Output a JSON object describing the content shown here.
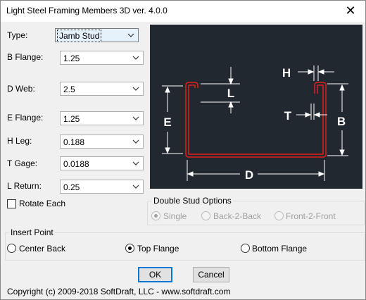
{
  "window": {
    "title": "Light Steel Framing Members 3D ver. 4.0.0",
    "close_glyph": "✕"
  },
  "fields": [
    {
      "label": "Type:",
      "value": "Jamb Stud"
    },
    {
      "label": "B Flange:",
      "value": "1.25"
    },
    {
      "label": "D Web:",
      "value": "2.5"
    },
    {
      "label": "E Flange:",
      "value": "1.25"
    },
    {
      "label": "H Leg:",
      "value": "0.188"
    },
    {
      "label": "T Gage:",
      "value": "0.0188"
    },
    {
      "label": "L Return:",
      "value": "0.25"
    }
  ],
  "rotate_each": {
    "label": "Rotate Each",
    "checked": false
  },
  "preview": {
    "labels": {
      "H": "H",
      "L": "L",
      "E": "E",
      "T": "T",
      "B": "B",
      "D": "D"
    },
    "colors": {
      "background": "#21282f",
      "profile": "#e0201c",
      "dimension": "#ffffff"
    }
  },
  "double_stud": {
    "title": "Double Stud Options",
    "options": [
      "Single",
      "Back-2-Back",
      "Front-2-Front"
    ],
    "selected": "Single",
    "disabled": true
  },
  "insert_point": {
    "title": "Insert Point",
    "options": [
      "Center Back",
      "Top Flange",
      "Bottom Flange"
    ],
    "selected": "Top Flange"
  },
  "buttons": {
    "ok": "OK",
    "cancel": "Cancel"
  },
  "copyright": "Copyright (c) 2009-2018 SoftDraft, LLC - www.softdraft.com"
}
